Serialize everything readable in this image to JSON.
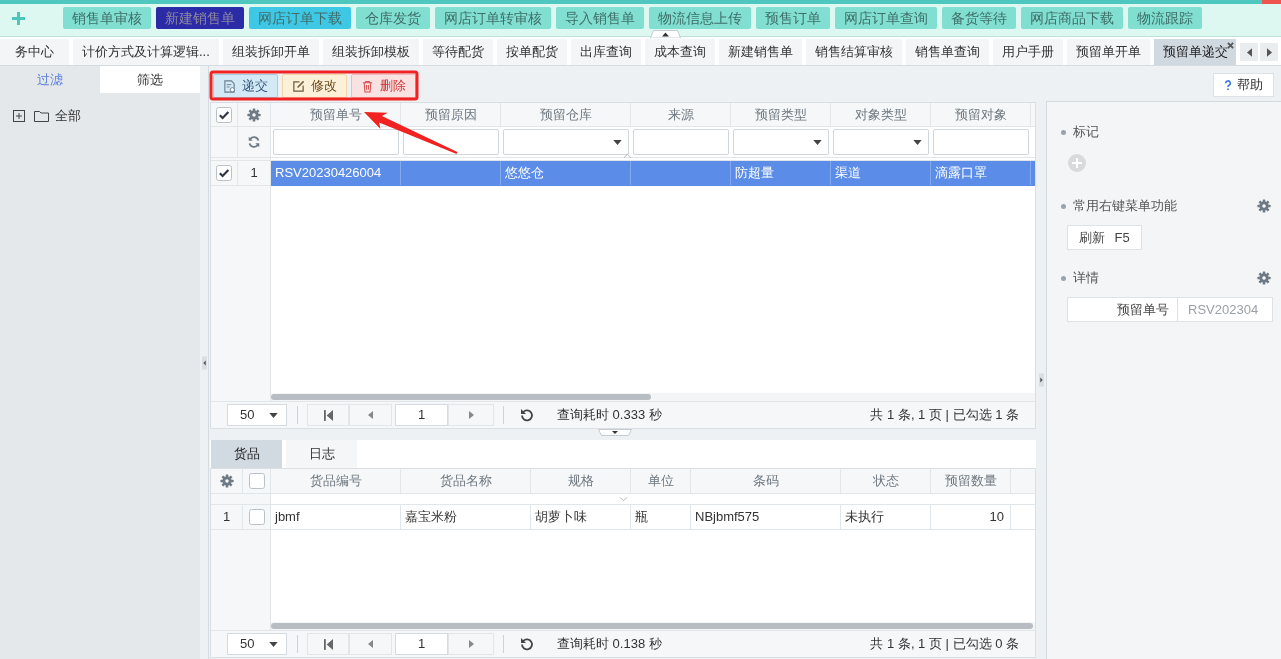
{
  "quick_toolbar": {
    "buttons": [
      {
        "label": "销售单审核",
        "color": "#80dfd1"
      },
      {
        "label": "新建销售单",
        "color": "#2b2aa7"
      },
      {
        "label": "网店订单下载",
        "color": "#3ec8e6"
      },
      {
        "label": "仓库发货",
        "color": "#80dfd1"
      },
      {
        "label": "网店订单转审核",
        "color": "#80dfd1"
      },
      {
        "label": "导入销售单",
        "color": "#80dfd1"
      },
      {
        "label": "物流信息上传",
        "color": "#80dfd1"
      },
      {
        "label": "预售订单",
        "color": "#80dfd1"
      },
      {
        "label": "网店订单查询",
        "color": "#80dfd1"
      },
      {
        "label": "备货等待",
        "color": "#80dfd1"
      },
      {
        "label": "网店商品下载",
        "color": "#80dfd1"
      },
      {
        "label": "物流跟踪",
        "color": "#80dfd1"
      }
    ]
  },
  "tab_bar": {
    "tabs": [
      {
        "label": "务中心",
        "selected": false
      },
      {
        "label": "计价方式及计算逻辑...",
        "selected": false
      },
      {
        "label": "组装拆卸开单",
        "selected": false
      },
      {
        "label": "组装拆卸模板",
        "selected": false
      },
      {
        "label": "等待配货",
        "selected": false
      },
      {
        "label": "按单配货",
        "selected": false
      },
      {
        "label": "出库查询",
        "selected": false
      },
      {
        "label": "成本查询",
        "selected": false
      },
      {
        "label": "新建销售单",
        "selected": false
      },
      {
        "label": "销售结算审核",
        "selected": false
      },
      {
        "label": "销售单查询",
        "selected": false
      },
      {
        "label": "用户手册",
        "selected": false
      },
      {
        "label": "预留单开单",
        "selected": false
      },
      {
        "label": "预留单递交",
        "selected": true
      }
    ]
  },
  "sidebar": {
    "tabs": [
      {
        "label": "过滤",
        "selected": true
      },
      {
        "label": "筛选",
        "selected": false
      }
    ],
    "tree": [
      {
        "label": "全部",
        "expanded": false
      }
    ]
  },
  "toolbar": {
    "buttons": [
      {
        "label": "递交",
        "kind": "submit"
      },
      {
        "label": "修改",
        "kind": "edit"
      },
      {
        "label": "删除",
        "kind": "delete"
      }
    ],
    "help_button": "帮助"
  },
  "main_grid": {
    "all_checked": true,
    "columns": [
      {
        "label": "预留单号",
        "kind": "text"
      },
      {
        "label": "预留原因",
        "kind": "text"
      },
      {
        "label": "预留仓库",
        "kind": "dropdown"
      },
      {
        "label": "来源",
        "kind": "text"
      },
      {
        "label": "预留类型",
        "kind": "dropdown"
      },
      {
        "label": "对象类型",
        "kind": "dropdown"
      },
      {
        "label": "预留对象",
        "kind": "text"
      }
    ],
    "rows": [
      {
        "number": "1",
        "checked": true,
        "selected": true,
        "cells": [
          "RSV20230426004",
          null,
          "悠悠仓",
          null,
          "防超量",
          "渠道",
          "滴露口罩"
        ]
      }
    ],
    "pager": {
      "page_size": "50",
      "page": "1",
      "timing": "查询耗时 0.333 秒",
      "summary": "共 1 条, 1 页 | 已勾选 1 条"
    }
  },
  "detail_tabs": [
    {
      "label": "货品",
      "selected": true
    },
    {
      "label": "日志",
      "selected": false
    }
  ],
  "items_grid": {
    "all_checked": false,
    "columns": [
      {
        "label": "货品编号",
        "kind": "text"
      },
      {
        "label": "货品名称",
        "kind": "text"
      },
      {
        "label": "规格",
        "kind": "text"
      },
      {
        "label": "单位",
        "kind": "text"
      },
      {
        "label": "条码",
        "kind": "text"
      },
      {
        "label": "状态",
        "kind": "text"
      },
      {
        "label": "预留数量",
        "kind": "number"
      }
    ],
    "rows": [
      {
        "number": "1",
        "checked": false,
        "cells": [
          "jbmf",
          "嘉宝米粉",
          "胡萝卜味",
          "瓶",
          "NBjbmf575",
          "未执行",
          "10"
        ]
      }
    ],
    "pager": {
      "page_size": "50",
      "page": "1",
      "timing": "查询耗时 0.138 秒",
      "summary": "共 1 条, 1 页 | 已勾选 0 条"
    }
  },
  "side_panel": {
    "sections": [
      {
        "title": "标记",
        "kind": "tags",
        "settings": false
      },
      {
        "title": "常用右键菜单功能",
        "kind": "shortcuts",
        "settings": true,
        "buttons": [
          {
            "label": "刷新 F5"
          }
        ]
      },
      {
        "title": "详情",
        "kind": "details",
        "settings": true,
        "fields": [
          {
            "label": "预留单号",
            "value": "RSV202304"
          }
        ]
      }
    ]
  }
}
